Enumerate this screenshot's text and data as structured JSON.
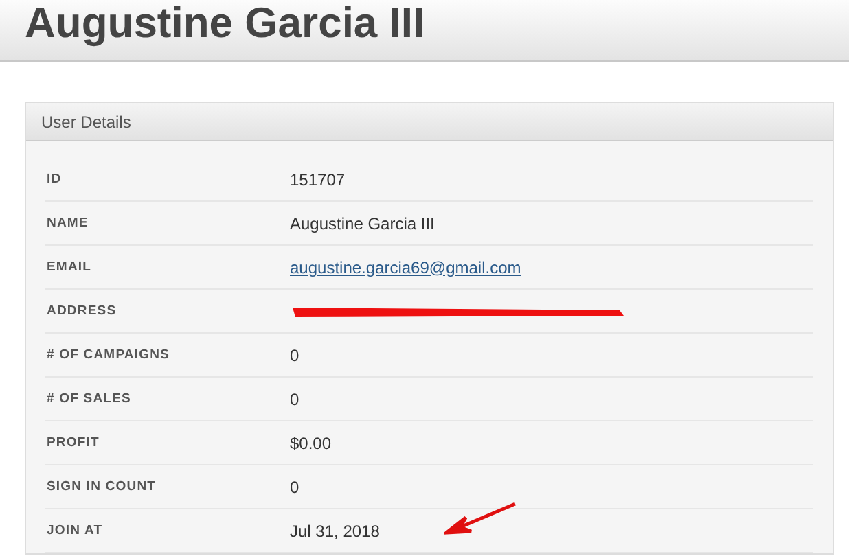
{
  "page": {
    "title": "Augustine Garcia III"
  },
  "panel": {
    "title": "User Details",
    "rows": [
      {
        "label": "ID",
        "kind": "text",
        "value": "151707",
        "marked": false
      },
      {
        "label": "NAME",
        "kind": "text",
        "value": "Augustine Garcia III",
        "marked": false
      },
      {
        "label": "EMAIL",
        "kind": "link",
        "value": "augustine.garcia69@gmail.com",
        "marked": false
      },
      {
        "label": "ADDRESS",
        "kind": "redacted",
        "marked": false
      },
      {
        "label": "# OF CAMPAIGNS",
        "kind": "text",
        "value": "0",
        "marked": false
      },
      {
        "label": "# OF SALES",
        "kind": "text",
        "value": "0",
        "marked": false
      },
      {
        "label": "PROFIT",
        "kind": "text",
        "value": "$0.00",
        "marked": false
      },
      {
        "label": "SIGN IN COUNT",
        "kind": "text",
        "value": "0",
        "marked": false
      },
      {
        "label": "JOIN AT",
        "kind": "text",
        "value": "Jul 31, 2018",
        "marked": true
      }
    ]
  }
}
